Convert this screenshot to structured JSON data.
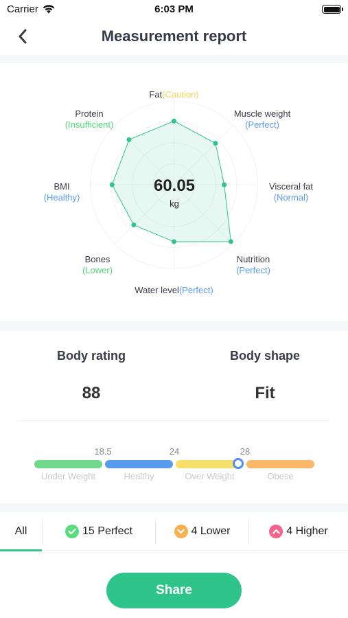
{
  "status_bar": {
    "carrier": "Carrier",
    "time": "6:03 PM"
  },
  "nav": {
    "title": "Measurement report"
  },
  "colors": {
    "accent": "#2fc58a",
    "insufficient": "#4fd77b",
    "healthy": "#5a9bf0",
    "caution": "#f4d35e"
  },
  "radar": {
    "center_value": "60.05",
    "center_unit": "kg",
    "metrics": [
      {
        "name": "Fat",
        "status": "(Caution)",
        "status_color": "#f4d35e",
        "score": 0.76
      },
      {
        "name": "Muscle weight",
        "status": "(Perfect)",
        "status_color": "#5a9bf0",
        "score": 0.7
      },
      {
        "name": "Visceral fat",
        "status": "(Normal)",
        "status_color": "#5a9bf0",
        "score": 0.6
      },
      {
        "name": "Nutrition",
        "status": "(Perfect)",
        "status_color": "#5a9bf0",
        "score": 0.96
      },
      {
        "name": "Water level",
        "status": "(Perfect)",
        "status_color": "#5a9bf0",
        "score": 0.68
      },
      {
        "name": "Bones",
        "status": "(Lower)",
        "status_color": "#4fd77b",
        "score": 0.68
      },
      {
        "name": "BMI",
        "status": "(Healthy)",
        "status_color": "#5a9bf0",
        "score": 0.74
      },
      {
        "name": "Protein",
        "status": "(Insufficient)",
        "status_color": "#4fd77b",
        "score": 0.76
      }
    ]
  },
  "ratings": {
    "body_rating": {
      "label": "Body rating",
      "value": "88"
    },
    "body_shape": {
      "label": "Body shape",
      "value": "Fit"
    }
  },
  "bmi_scale": {
    "ticks": [
      "18.5",
      "24",
      "28"
    ],
    "segments": [
      {
        "label": "Under Weight",
        "color": "#6fd98a"
      },
      {
        "label": "Healthy",
        "color": "#5a9bf0"
      },
      {
        "label": "Over Weight",
        "color": "#f9e06b"
      },
      {
        "label": "Obese",
        "color": "#f8b868"
      }
    ],
    "marker_fraction": 0.727
  },
  "tabs": [
    {
      "label": "All"
    },
    {
      "label": "15 Perfect",
      "icon": "check-icon",
      "color": "#5ddc7d"
    },
    {
      "label": "4 Lower",
      "icon": "chevron-down-icon",
      "color": "#f7b24f"
    },
    {
      "label": "4 Higher",
      "icon": "chevron-up-icon",
      "color": "#f4648f"
    }
  ],
  "share_label": "Share"
}
